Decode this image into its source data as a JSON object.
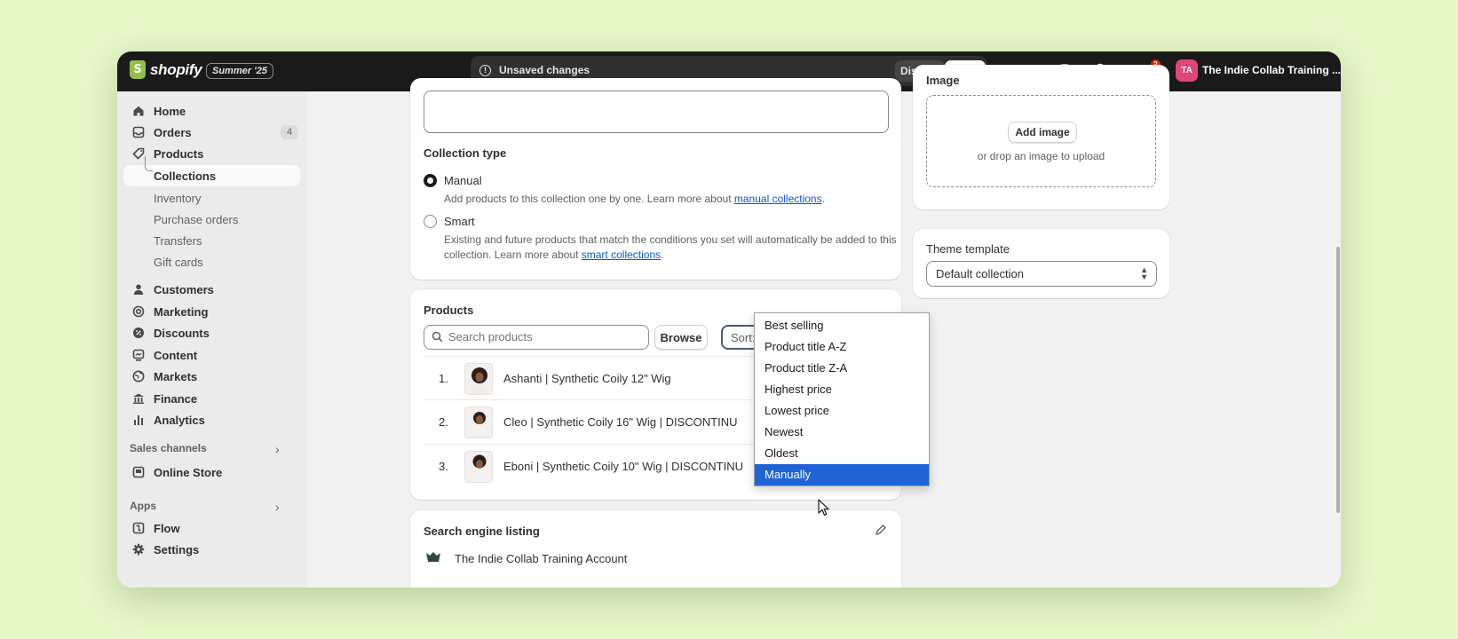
{
  "topbar": {
    "logo_text": "shopify",
    "edition": "Summer '25",
    "unsaved_text": "Unsaved changes",
    "discard_label": "Discard",
    "save_label": "Save",
    "notification_count": "2",
    "avatar_initials": "TA",
    "store_name": "The Indie Collab Training ..."
  },
  "sidebar": {
    "items": [
      {
        "label": "Home",
        "icon": "home-icon"
      },
      {
        "label": "Orders",
        "icon": "inbox-icon",
        "count": "4"
      },
      {
        "label": "Products",
        "icon": "tag-icon"
      },
      {
        "label": "Collections"
      },
      {
        "label": "Inventory"
      },
      {
        "label": "Purchase orders"
      },
      {
        "label": "Transfers"
      },
      {
        "label": "Gift cards"
      },
      {
        "label": "Customers",
        "icon": "person-icon"
      },
      {
        "label": "Marketing",
        "icon": "target-icon"
      },
      {
        "label": "Discounts",
        "icon": "discount-icon"
      },
      {
        "label": "Content",
        "icon": "content-icon"
      },
      {
        "label": "Markets",
        "icon": "globe-icon"
      },
      {
        "label": "Finance",
        "icon": "bank-icon"
      },
      {
        "label": "Analytics",
        "icon": "bar-chart-icon"
      }
    ],
    "sales_channels_label": "Sales channels",
    "online_store_label": "Online Store",
    "apps_label": "Apps",
    "flow_label": "Flow",
    "settings_label": "Settings"
  },
  "collection_type": {
    "title": "Collection type",
    "manual_label": "Manual",
    "manual_help": "Add products to this collection one by one. Learn more about ",
    "manual_link": "manual collections",
    "smart_label": "Smart",
    "smart_help_1": "Existing and future products that match the conditions you set will automatically be added to this",
    "smart_help_2": "collection. Learn more about ",
    "smart_link": "smart collections",
    "selected": "Manual"
  },
  "products": {
    "title": "Products",
    "search_placeholder": "Search products",
    "browse_label": "Browse",
    "sort_label": "Sort: Best selling",
    "rows": [
      {
        "num": "1.",
        "title": "Ashanti | Synthetic Coily 12\" Wig"
      },
      {
        "num": "2.",
        "title": "Cleo | Synthetic Coily 16\" Wig | DISCONTINU"
      },
      {
        "num": "3.",
        "title": "Eboni | Synthetic Coily 10\" Wig | DISCONTINU"
      }
    ],
    "sort_options": [
      "Best selling",
      "Product title A-Z",
      "Product title Z-A",
      "Highest price",
      "Lowest price",
      "Newest",
      "Oldest",
      "Manually"
    ],
    "highlighted_option": "Manually"
  },
  "seo": {
    "title": "Search engine listing",
    "store_name": "The Indie Collab Training Account"
  },
  "image_card": {
    "title": "Image",
    "add_image_label": "Add image",
    "hint": "or drop an image to upload"
  },
  "theme_template": {
    "label": "Theme template",
    "value": "Default collection"
  }
}
